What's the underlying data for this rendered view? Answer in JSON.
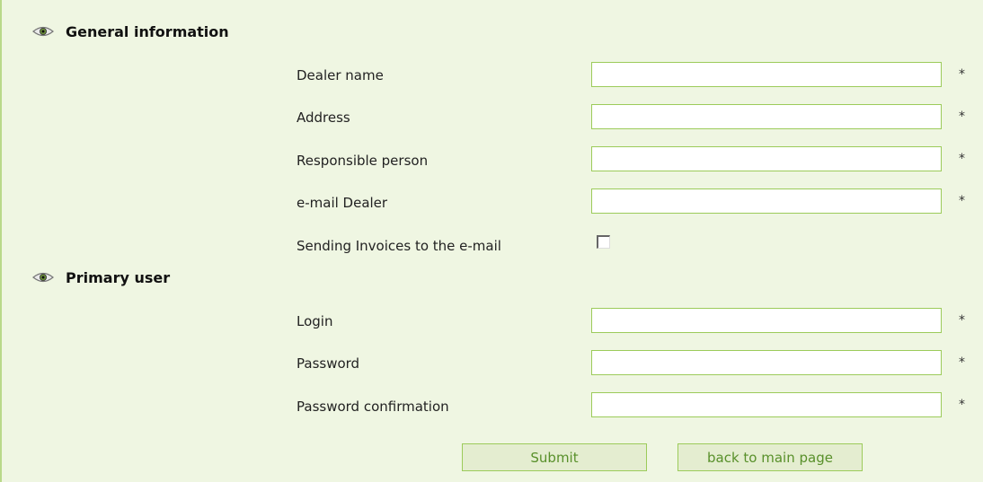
{
  "sections": {
    "general": {
      "title": "General information",
      "fields": {
        "dealer_name": {
          "label": "Dealer name",
          "value": "",
          "required": "*"
        },
        "address": {
          "label": "Address",
          "value": "",
          "required": "*"
        },
        "responsible_person": {
          "label": "Responsible person",
          "value": "",
          "required": "*"
        },
        "email_dealer": {
          "label": "e-mail Dealer",
          "value": "",
          "required": "*"
        }
      },
      "send_invoices": {
        "label": "Sending Invoices to the e-mail",
        "checked": false
      }
    },
    "primary_user": {
      "title": "Primary user",
      "fields": {
        "login": {
          "label": "Login",
          "value": "",
          "required": "*"
        },
        "password": {
          "label": "Password",
          "value": "",
          "required": "*"
        },
        "password_confirmation": {
          "label": "Password confirmation",
          "value": "",
          "required": "*"
        }
      }
    }
  },
  "buttons": {
    "submit_label": "Submit",
    "back_label": "back to main page"
  },
  "icons": {
    "section_icon": "eye-icon"
  },
  "colors": {
    "panel_background": "#eff6e2",
    "border_accent": "#9ccb5a",
    "button_background": "#e4edd0",
    "button_text": "#58902a"
  }
}
